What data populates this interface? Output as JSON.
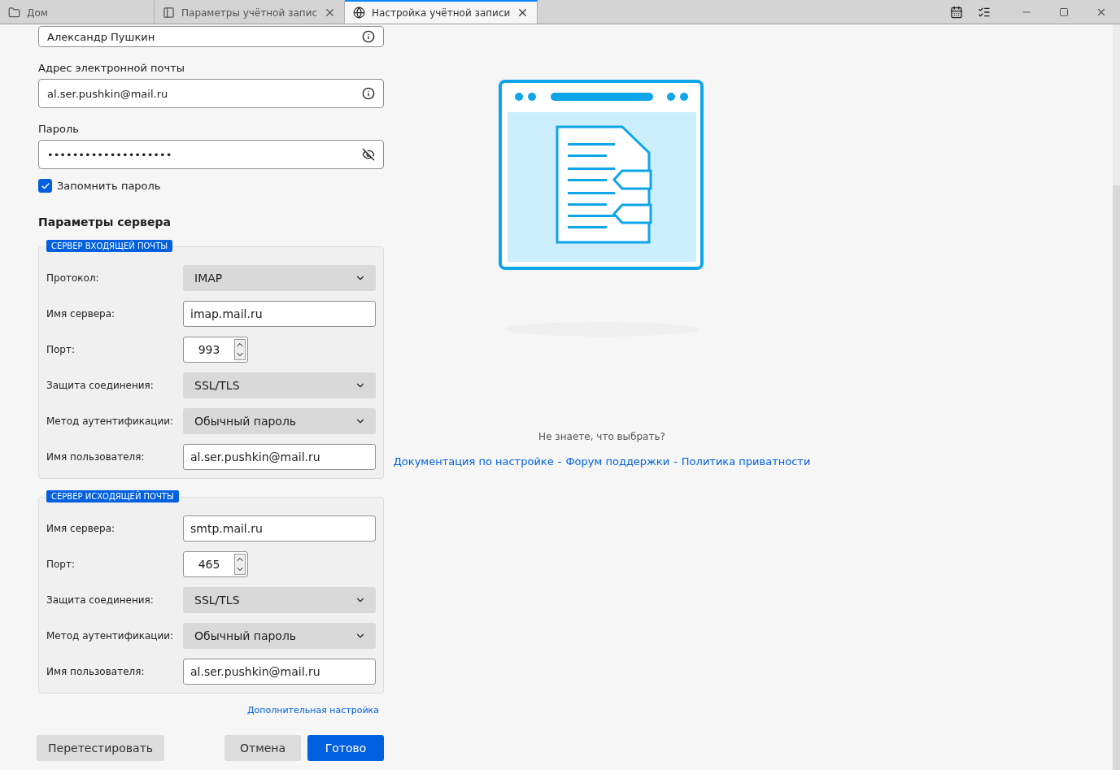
{
  "tabs": [
    {
      "label": "Дом",
      "selected": false,
      "closable": false
    },
    {
      "label": "Параметры учётной запис",
      "selected": false,
      "closable": true
    },
    {
      "label": "Настройка учётной записи",
      "selected": true,
      "closable": true
    }
  ],
  "account": {
    "name_value": "Александр Пушкин",
    "email_label": "Адрес электронной почты",
    "email_value": "al.ser.pushkin@mail.ru",
    "password_label": "Пароль",
    "password_value": "••••••••••••••••••••",
    "remember_label": "Запомнить пароль",
    "remember_checked": true
  },
  "server_title": "Параметры сервера",
  "servers": [
    {
      "legend": "СЕРВЕР ВХОДЯЩЕЙ ПОЧТЫ",
      "rows": [
        {
          "kind": "select",
          "label": "Протокол:",
          "value": "IMAP"
        },
        {
          "kind": "text",
          "label": "Имя сервера:",
          "value": "imap.mail.ru"
        },
        {
          "kind": "spin",
          "label": "Порт:",
          "value": "993"
        },
        {
          "kind": "select",
          "label": "Защита соединения:",
          "value": "SSL/TLS"
        },
        {
          "kind": "select",
          "label": "Метод аутентификации:",
          "value": "Обычный пароль"
        },
        {
          "kind": "text",
          "label": "Имя пользователя:",
          "value": "al.ser.pushkin@mail.ru"
        }
      ]
    },
    {
      "legend": "СЕРВЕР ИСХОДЯЩЕЙ ПОЧТЫ",
      "rows": [
        {
          "kind": "text",
          "label": "Имя сервера:",
          "value": "smtp.mail.ru"
        },
        {
          "kind": "spin",
          "label": "Порт:",
          "value": "465"
        },
        {
          "kind": "select",
          "label": "Защита соединения:",
          "value": "SSL/TLS"
        },
        {
          "kind": "select",
          "label": "Метод аутентификации:",
          "value": "Обычный пароль"
        },
        {
          "kind": "text",
          "label": "Имя пользователя:",
          "value": "al.ser.pushkin@mail.ru"
        }
      ]
    }
  ],
  "advanced_link": "Дополнительная настройка",
  "buttons": [
    {
      "label": "Перетестировать",
      "kind": "secondary"
    },
    {
      "label": "Отмена",
      "kind": "secondary"
    },
    {
      "label": "Готово",
      "kind": "primary"
    }
  ],
  "help": {
    "question": "Не знаете, что выбрать?",
    "links": [
      "Документация по настройке",
      "Форум поддержки",
      "Политика приватности"
    ],
    "separator": "-"
  }
}
